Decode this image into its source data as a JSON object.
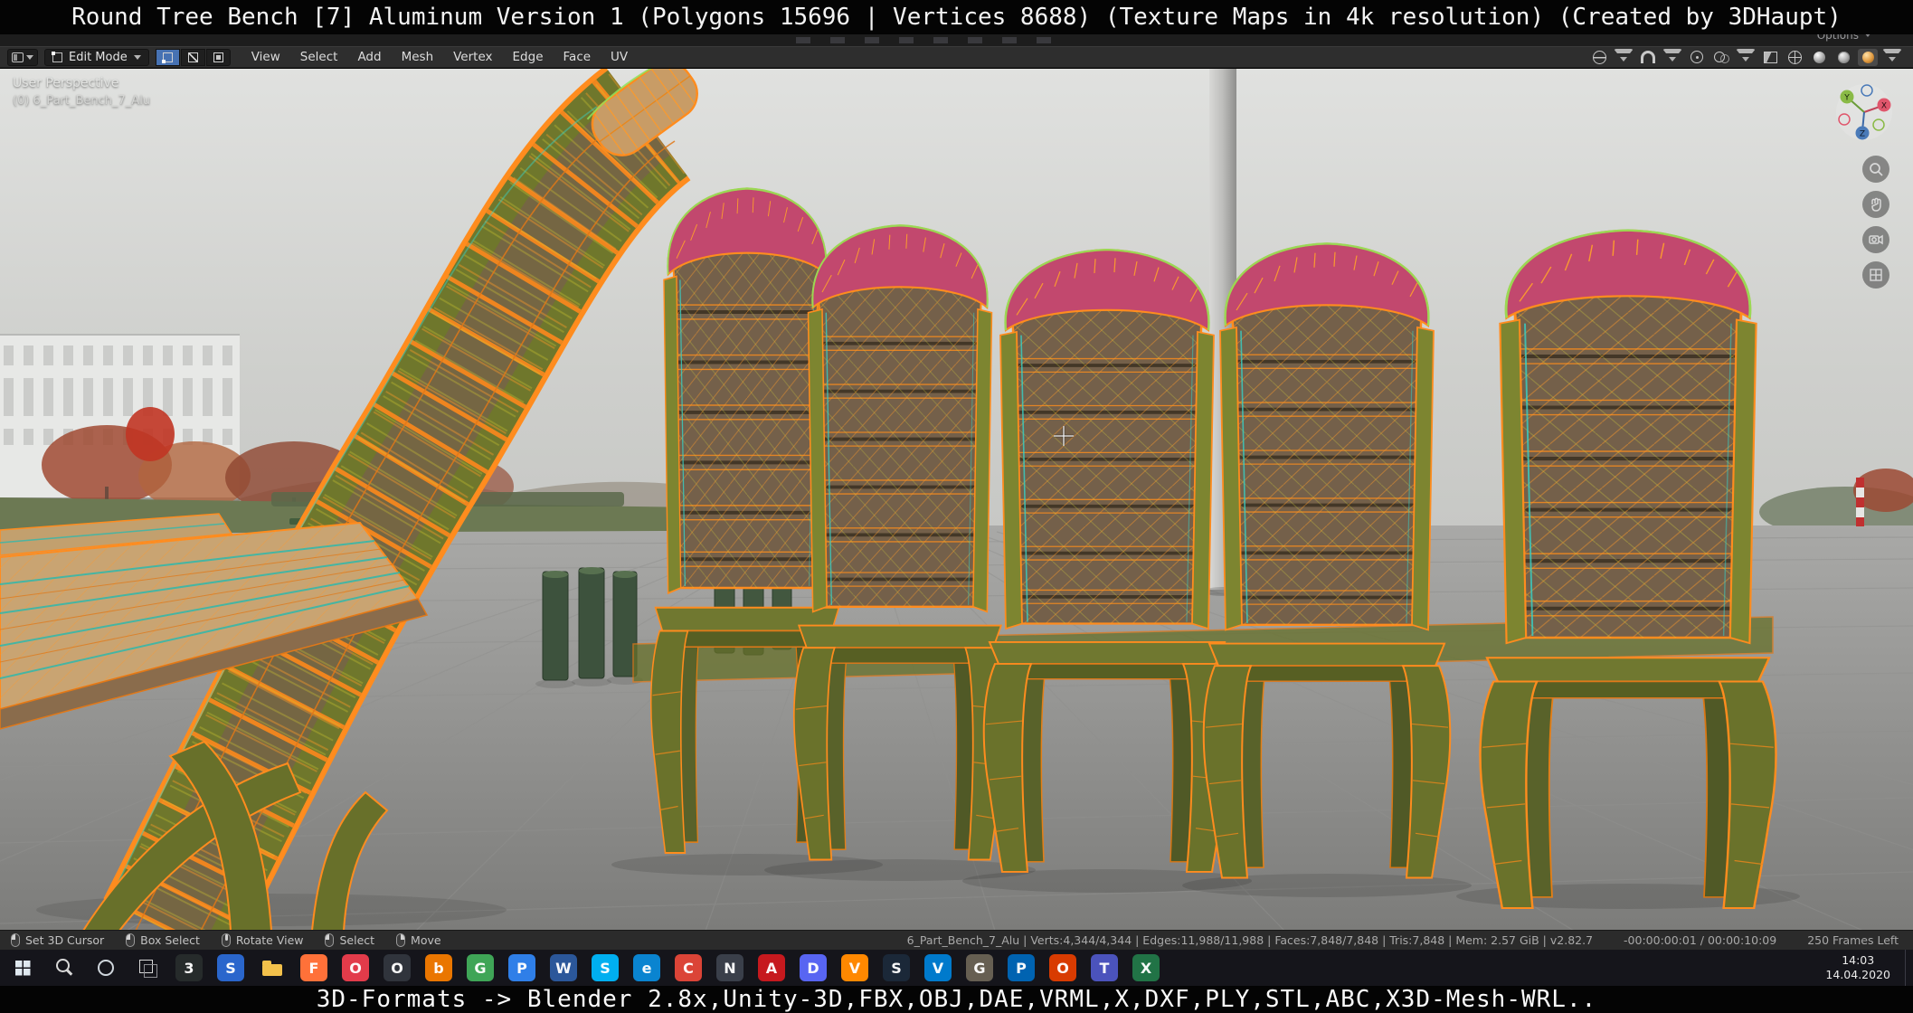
{
  "caption_top": "Round Tree Bench [7] Aluminum Version 1 (Polygons 15696 | Vertices 8688) (Texture Maps in 4k resolution) (Created by 3DHaupt)",
  "caption_bottom": "3D-Formats -> Blender 2.8x,Unity-3D,FBX,OBJ,DAE,VRML,X,DXF,PLY,STL,ABC,X3D-Mesh-WRL..",
  "topbar": {
    "options_label": "Options"
  },
  "header": {
    "mode_label": "Edit Mode",
    "menus": [
      "View",
      "Select",
      "Add",
      "Mesh",
      "Vertex",
      "Edge",
      "Face",
      "UV"
    ],
    "select_modes": [
      {
        "name": "vertex-select-mode-button",
        "icon": "ic-vertex",
        "state": "active"
      },
      {
        "name": "edge-select-mode-button",
        "icon": "ic-edge",
        "state": ""
      },
      {
        "name": "face-select-mode-button",
        "icon": "ic-face",
        "state": ""
      }
    ],
    "right_icons": [
      {
        "name": "transform-orientation-globe-icon",
        "shape": "globe",
        "state": ""
      },
      {
        "name": "transform-orientation-chevron-icon",
        "shape": "chev",
        "state": ""
      },
      {
        "name": "snap-magnet-icon",
        "shape": "magnet",
        "state": ""
      },
      {
        "name": "snap-chevron-icon",
        "shape": "chev",
        "state": ""
      },
      {
        "name": "proportional-editing-icon",
        "shape": "ring",
        "state": ""
      },
      {
        "name": "show-overlays-icon",
        "shape": "overlay",
        "state": ""
      },
      {
        "name": "overlays-chevron-icon",
        "shape": "chev",
        "state": ""
      },
      {
        "name": "xray-toggle-icon",
        "shape": "xray",
        "state": ""
      },
      {
        "name": "shading-wireframe-icon",
        "shape": "sphere-wire",
        "state": ""
      },
      {
        "name": "shading-solid-icon",
        "shape": "sphere-solid",
        "state": ""
      },
      {
        "name": "shading-material-icon",
        "shape": "sphere-mat",
        "state": ""
      },
      {
        "name": "shading-rendered-icon",
        "shape": "sphere-rend",
        "state": "active"
      },
      {
        "name": "shading-chevron-icon",
        "shape": "chev",
        "state": ""
      }
    ]
  },
  "viewport": {
    "projection_label": "User Perspective",
    "object_label": "(0) 6_Part_Bench_7_Alu",
    "gizmo": {
      "x": "X",
      "y": "Y",
      "z": "Z"
    }
  },
  "statusbar": {
    "hints": [
      {
        "name": "hint-set-3d-cursor",
        "mouse": "mouse-lmb",
        "label": "Set 3D Cursor"
      },
      {
        "name": "hint-box-select",
        "mouse": "mouse-lmb",
        "label": "Box Select"
      },
      {
        "name": "hint-rotate-view",
        "mouse": "mouse-mmb",
        "label": "Rotate View"
      },
      {
        "name": "hint-select",
        "mouse": "mouse-lmb",
        "label": "Select"
      },
      {
        "name": "hint-move",
        "mouse": "mouse-rmb",
        "label": "Move"
      }
    ],
    "stats": "6_Part_Bench_7_Alu | Verts:4,344/4,344 | Edges:11,988/11,988 | Faces:7,848/7,848 | Tris:7,848 | Mem: 2.57 GiB | v2.82.7",
    "timecode": "-00:00:00:01 / 00:00:10:09",
    "frames_left": "250 Frames Left"
  },
  "taskbar": {
    "time": "14:03",
    "date": "14.04.2020",
    "icons": [
      {
        "name": "start-button",
        "shape": "win",
        "glyph": "",
        "color": ""
      },
      {
        "name": "search-button",
        "shape": "search",
        "glyph": "",
        "color": ""
      },
      {
        "name": "cortana-button",
        "shape": "ring-lg",
        "glyph": "",
        "color": ""
      },
      {
        "name": "task-view-button",
        "shape": "taskview",
        "glyph": "",
        "color": ""
      },
      {
        "name": "app-3ds-max",
        "glyph": "3",
        "color": "#262b2b"
      },
      {
        "name": "app-save",
        "glyph": "S",
        "color": "#2a66cc"
      },
      {
        "name": "file-explorer",
        "shape": "folder",
        "glyph": "",
        "color": ""
      },
      {
        "name": "app-firefox",
        "glyph": "F",
        "color": "#ff7139"
      },
      {
        "name": "app-opera",
        "glyph": "O",
        "color": "#e23b4a"
      },
      {
        "name": "app-obs",
        "glyph": "O",
        "color": "#30343c"
      },
      {
        "name": "app-blender",
        "glyph": "b",
        "color": "#ea7600"
      },
      {
        "name": "app-greenshot",
        "glyph": "G",
        "color": "#3fa557"
      },
      {
        "name": "app-photos",
        "glyph": "P",
        "color": "#2f7fe8"
      },
      {
        "name": "app-word",
        "glyph": "W",
        "color": "#2b579a"
      },
      {
        "name": "app-skype",
        "glyph": "S",
        "color": "#00aff0"
      },
      {
        "name": "app-edge",
        "glyph": "e",
        "color": "#0a84d0"
      },
      {
        "name": "app-chrome",
        "glyph": "C",
        "color": "#db4437"
      },
      {
        "name": "app-notepad",
        "glyph": "N",
        "color": "#3a3f4a"
      },
      {
        "name": "app-adobe-reader",
        "glyph": "A",
        "color": "#c6191e"
      },
      {
        "name": "app-discord",
        "glyph": "D",
        "color": "#5865f2"
      },
      {
        "name": "app-vlc",
        "glyph": "V",
        "color": "#ff8800"
      },
      {
        "name": "app-steam",
        "glyph": "S",
        "color": "#1b2838"
      },
      {
        "name": "app-vscode",
        "glyph": "V",
        "color": "#007acc"
      },
      {
        "name": "app-gimp",
        "glyph": "G",
        "color": "#665f52"
      },
      {
        "name": "app-your-phone",
        "glyph": "P",
        "color": "#0063b1"
      },
      {
        "name": "app-office",
        "glyph": "O",
        "color": "#d83b01"
      },
      {
        "name": "app-teams",
        "glyph": "T",
        "color": "#4b53bc"
      },
      {
        "name": "app-excel",
        "glyph": "X",
        "color": "#217346"
      }
    ]
  },
  "colors": {
    "wire_orange": "#ff8c1e",
    "selected_face_pink": "#c2486e",
    "edge_highlight_green": "#8fe05a",
    "seam_cyan": "#36d2c8",
    "active_blue": "#4772b3"
  }
}
